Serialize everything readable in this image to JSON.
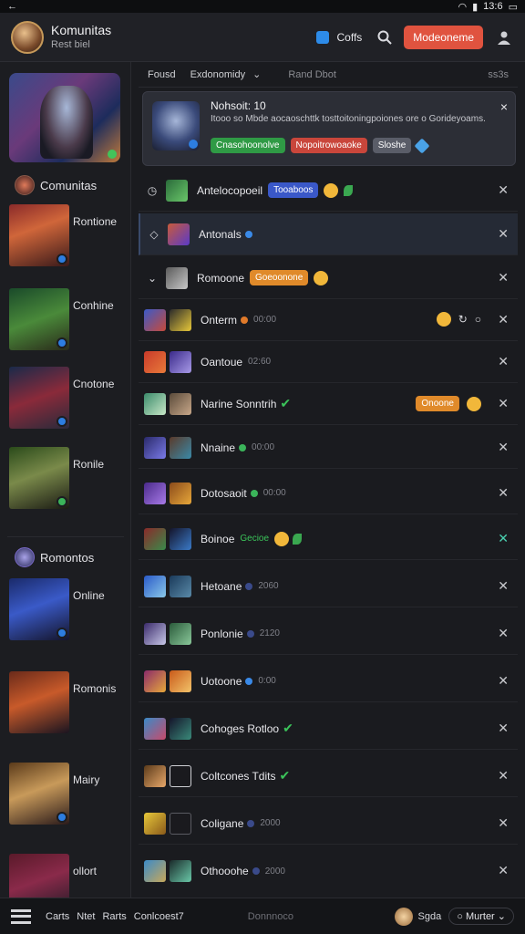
{
  "statusbar": {
    "back": "←",
    "time": "13:6"
  },
  "topbar": {
    "title": "Komunitas",
    "subtitle": "Rest biel",
    "category": "Coffs",
    "cta": "Modeoneme"
  },
  "sidebar": {
    "group1": "Comunitas",
    "group2": "Romontos",
    "items": [
      {
        "label": "Rontione"
      },
      {
        "label": "Conhine"
      },
      {
        "label": "Cnotone"
      },
      {
        "label": "Ronile"
      },
      {
        "label": "Online"
      },
      {
        "label": "Romonis"
      },
      {
        "label": "Mairy"
      },
      {
        "label": "ollort"
      }
    ]
  },
  "filters": {
    "f1": "Fousd",
    "f2": "Exdonomidy",
    "f3": "Rand Dbot",
    "f4": "ss3s"
  },
  "notice": {
    "title": "Nohsoit: 10",
    "body": "Itooo so Mbde aocaoschttk tosttoitoningpoiones ore o Gorideyoams.",
    "btn1": "Cnasohoonolve",
    "btn2": "Nopoitrowoaoke",
    "btn3": "Sloshe",
    "close": "×"
  },
  "rows": [
    {
      "lead": "◷",
      "name": "Antelocopoeil",
      "tag": "Tooaboos"
    },
    {
      "lead": "◇",
      "name": "Antonals"
    },
    {
      "lead": "⌄",
      "name": "Romoone",
      "tag": "Goeoonone"
    },
    {
      "name": "Onterm",
      "meta": "00:00"
    },
    {
      "name": "Oantoue",
      "meta": "02:60"
    },
    {
      "name": "Narine Sonntrih",
      "tag": "Onoone"
    },
    {
      "name": "Nnaine",
      "meta": "00:00"
    },
    {
      "name": "Dotosaoit",
      "meta": "00:00"
    },
    {
      "name": "Boinoe",
      "tag": "Gecioe"
    },
    {
      "name": "Hetoane",
      "meta": "2060"
    },
    {
      "name": "Ponlonie",
      "meta": "2120"
    },
    {
      "name": "Uotoone",
      "meta": "0:00"
    },
    {
      "name": "Cohoges Rotloo"
    },
    {
      "name": "Coltcones Tdits"
    },
    {
      "name": "Coligane",
      "meta": "2000"
    },
    {
      "name": "Othooohe",
      "meta": "2000"
    }
  ],
  "bottom": {
    "w1": "Carts",
    "w2": "Ntet",
    "w3": "Rarts",
    "w4": "Conlcoest7",
    "mid": "Donnnoco",
    "me": "Sgda",
    "select": "Murter"
  },
  "colors": {
    "accent": "#e0533f",
    "background": "#1a1b1f",
    "green": "#2f9a45",
    "blue": "#3a58c8"
  }
}
